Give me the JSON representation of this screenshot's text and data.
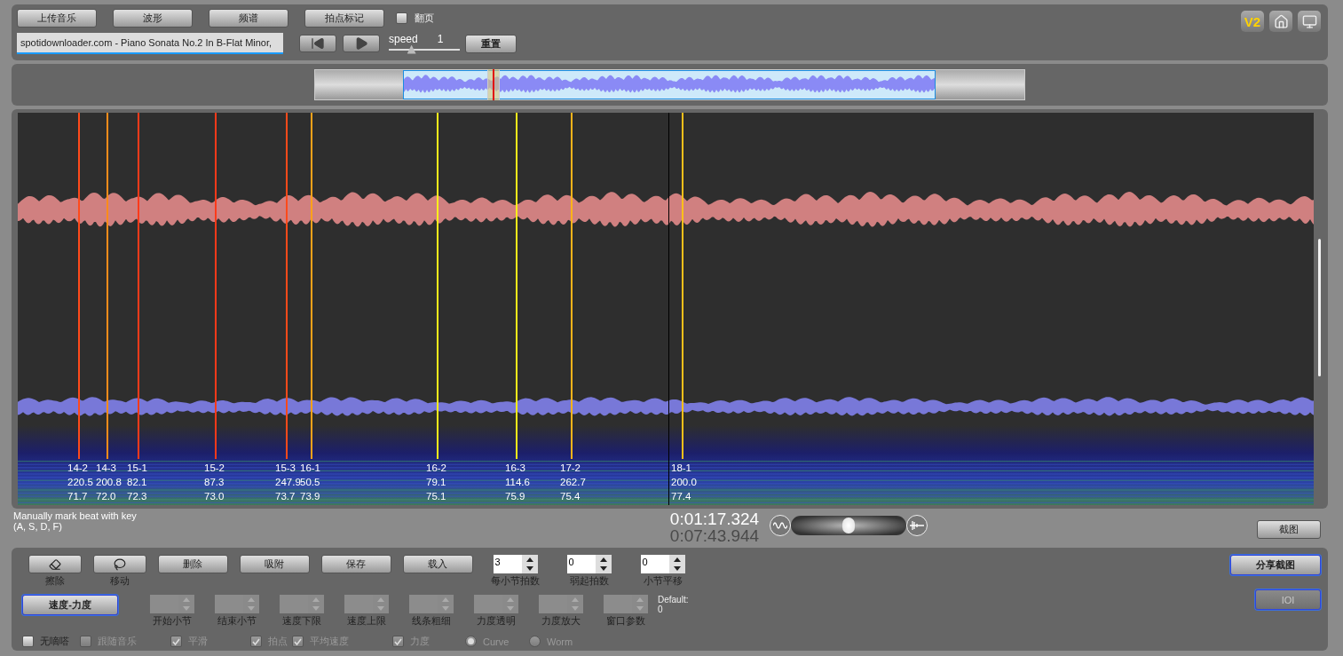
{
  "toolbar": {
    "buttons": [
      "上传音乐",
      "波形",
      "频谱",
      "拍点标记"
    ],
    "page_toggle": {
      "label": "翻页",
      "checked": false
    }
  },
  "file_field": {
    "value": "spotidownloader.com - Piano Sonata No.2 In B-Flat Minor,"
  },
  "speed": {
    "label": "speed",
    "value": "1",
    "level": 0.32
  },
  "reset_button": "重置",
  "version_badge": "V2",
  "beats": [
    {
      "label": "14-2",
      "tempo": "220.5",
      "dynamic": "71.7",
      "color": "#ff4a1a"
    },
    {
      "label": "14-3",
      "tempo": "200.8",
      "dynamic": "72.0",
      "color": "#ff8c1a"
    },
    {
      "label": "15-1",
      "tempo": "82.1",
      "dynamic": "72.3",
      "color": "#ff3a1a"
    },
    {
      "label": "15-2",
      "tempo": "87.3",
      "dynamic": "73.0",
      "color": "#ff3a1a"
    },
    {
      "label": "15-3",
      "tempo": "247.9",
      "dynamic": "73.7",
      "color": "#ff4a1a"
    },
    {
      "label": "16-1",
      "tempo": "50.5",
      "dynamic": "73.9",
      "color": "#ffa21a"
    },
    {
      "label": "16-2",
      "tempo": "79.1",
      "dynamic": "75.1",
      "color": "#ffee1a"
    },
    {
      "label": "16-3",
      "tempo": "114.6",
      "dynamic": "75.9",
      "color": "#ffee1a"
    },
    {
      "label": "17-2",
      "tempo": "262.7",
      "dynamic": "75.4",
      "color": "#ffb41a"
    },
    {
      "label": "18-1",
      "tempo": "200.0",
      "dynamic": "77.4",
      "color": "#ffc01a"
    }
  ],
  "hint": [
    "Manually mark beat with key",
    "(A, S, D, F)"
  ],
  "current_time": "0:01:17.324",
  "total_time": "0:07:43.944",
  "blend": {
    "level": 0.5
  },
  "screenshot_button": "截图",
  "tool_buttons": [
    {
      "label": "擦除",
      "kind": "eraser"
    },
    {
      "label": "移动",
      "kind": "lasso"
    }
  ],
  "action_buttons": [
    "删除",
    "吸附",
    "保存",
    "载入"
  ],
  "spinners": [
    {
      "value": "3",
      "label": "每小节拍数"
    },
    {
      "value": "0",
      "label": "弱起拍数"
    },
    {
      "value": "0",
      "label": "小节平移"
    }
  ],
  "mode_button": "速度-力度",
  "disabled_spinners": [
    "开始小节",
    "结束小节",
    "速度下限",
    "速度上限",
    "线条粗细",
    "力度透明",
    "力度放大",
    "窗口参数"
  ],
  "default_note": [
    "Default:",
    "0"
  ],
  "options": [
    {
      "kind": "checkbox",
      "label": "无嘀嗒",
      "checked": false,
      "disabled": false
    },
    {
      "kind": "checkbox",
      "label": "跟随音乐",
      "checked": false,
      "disabled": true
    },
    {
      "kind": "checkbox",
      "label": "平滑",
      "checked": true,
      "disabled": true
    },
    {
      "kind": "checkbox",
      "label": "拍点",
      "checked": true,
      "disabled": true
    },
    {
      "kind": "checkbox",
      "label": "平均速度",
      "checked": true,
      "disabled": true
    },
    {
      "kind": "checkbox",
      "label": "力度",
      "checked": true,
      "disabled": true
    },
    {
      "kind": "radio",
      "label": "Curve",
      "checked": true,
      "disabled": true
    },
    {
      "kind": "radio",
      "label": "Worm",
      "checked": false,
      "disabled": true
    }
  ],
  "share_button": {
    "label": "分享截图",
    "disabled": false
  },
  "ioi_button": {
    "label": "IOI",
    "disabled": true
  }
}
